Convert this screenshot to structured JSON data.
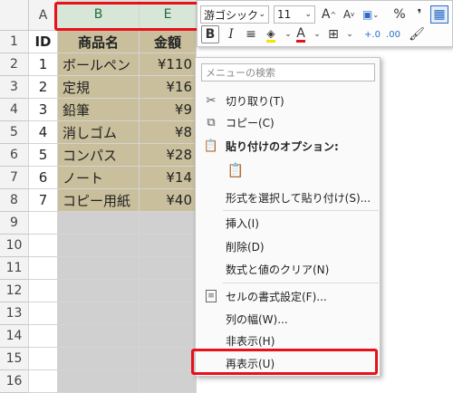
{
  "columns": {
    "a": "A",
    "b": "B",
    "e": "E"
  },
  "rows": [
    "1",
    "2",
    "3",
    "4",
    "5",
    "6",
    "7",
    "8",
    "9",
    "10",
    "11",
    "12",
    "13",
    "14",
    "15",
    "16"
  ],
  "header_row": {
    "id": "ID",
    "name": "商品名",
    "price": "金額"
  },
  "data_rows": [
    {
      "id": "1",
      "name": "ボールペン",
      "price": "¥110"
    },
    {
      "id": "2",
      "name": "定規",
      "price": "¥16"
    },
    {
      "id": "3",
      "name": "鉛筆",
      "price": "¥9"
    },
    {
      "id": "4",
      "name": "消しゴム",
      "price": "¥8"
    },
    {
      "id": "5",
      "name": "コンパス",
      "price": "¥28"
    },
    {
      "id": "6",
      "name": "ノート",
      "price": "¥14"
    },
    {
      "id": "7",
      "name": "コピー用紙",
      "price": "¥40"
    }
  ],
  "mini_toolbar": {
    "font_name": "游ゴシック",
    "font_size": "11",
    "grow": "A",
    "shrink": "A",
    "percent": "%",
    "comma": "❜",
    "bold": "B",
    "italic": "I",
    "font_color_letter": "A"
  },
  "context_menu": {
    "search_placeholder": "メニューの検索",
    "items": {
      "cut": "切り取り(T)",
      "copy": "コピー(C)",
      "paste_options": "貼り付けのオプション:",
      "paste_special": "形式を選択して貼り付け(S)...",
      "insert": "挿入(I)",
      "delete": "削除(D)",
      "clear": "数式と値のクリア(N)",
      "format_cells": "セルの書式設定(F)...",
      "col_width": "列の幅(W)...",
      "hide": "非表示(H)",
      "unhide": "再表示(U)"
    }
  },
  "colors": {
    "highlight": "#e8101a",
    "selected_header": "#217346",
    "table_fill": "#c9bf9c"
  }
}
